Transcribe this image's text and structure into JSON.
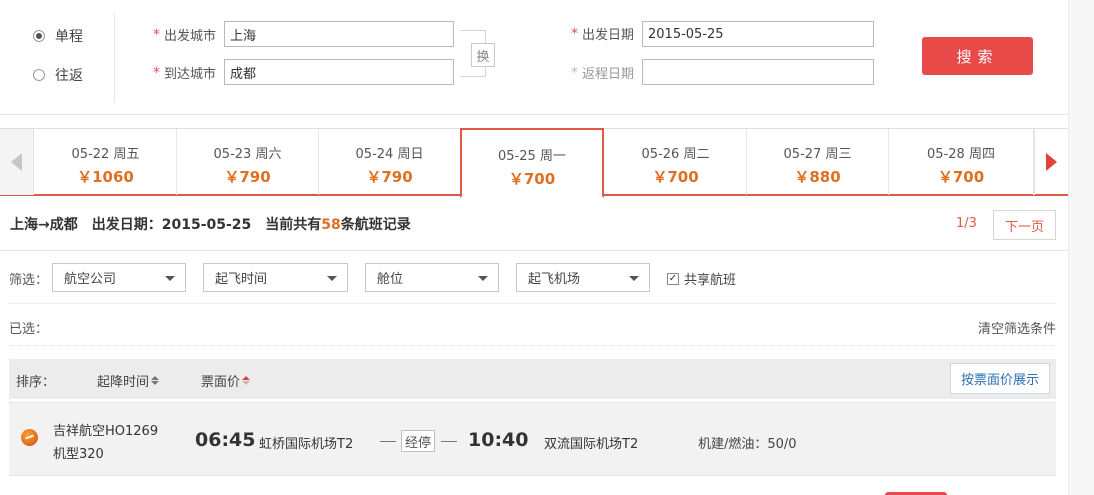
{
  "trip_type": {
    "one_way": "单程",
    "round_trip": "往返",
    "selected": "one_way"
  },
  "search": {
    "from_label": "出发城市",
    "from_value": "上海",
    "to_label": "到达城市",
    "to_value": "成都",
    "swap_label": "换",
    "depart_label": "出发日期",
    "depart_value": "2015-05-25",
    "return_label": "返程日期",
    "return_value": "",
    "required_mark": "*",
    "search_button": "搜索"
  },
  "date_tabs": [
    {
      "date": "05-22 周五",
      "price": "￥1060"
    },
    {
      "date": "05-23 周六",
      "price": "￥790"
    },
    {
      "date": "05-24 周日",
      "price": "￥790"
    },
    {
      "date": "05-25 周一",
      "price": "￥700",
      "active": true
    },
    {
      "date": "05-26 周二",
      "price": "￥700"
    },
    {
      "date": "05-27 周三",
      "price": "￥880"
    },
    {
      "date": "05-28 周四",
      "price": "￥700"
    }
  ],
  "summary": {
    "route": "上海→成都",
    "depart": "出发日期：2015-05-25",
    "count_prefix": "当前共有",
    "count": "58",
    "count_suffix": "条航班记录",
    "page": "1/3",
    "next_page": "下一页"
  },
  "filters": {
    "label": "筛选：",
    "airline": "航空公司",
    "depart_time": "起飞时间",
    "cabin": "舱位",
    "depart_airport": "起飞机场",
    "shared_checked": true,
    "shared_label": "共享航班",
    "selected_label": "已选：",
    "clear_label": "清空筛选条件"
  },
  "sort_bar": {
    "label": "排序：",
    "time": "起降时间",
    "price": "票面价",
    "display_btn": "按票面价展示"
  },
  "flights": [
    {
      "airline": "吉祥航空HO1269",
      "model": "机型320",
      "dep_time": "06:45",
      "dep_airport": "虹桥国际机场T2",
      "stop": "经停",
      "arr_time": "10:40",
      "arr_airport": "双流国际机场T2",
      "tax": "机建/燃油：50/0"
    }
  ],
  "colors": {
    "accent_red": "#e84a4a",
    "price_orange": "#e07021",
    "link_blue": "#2c6fb6"
  }
}
